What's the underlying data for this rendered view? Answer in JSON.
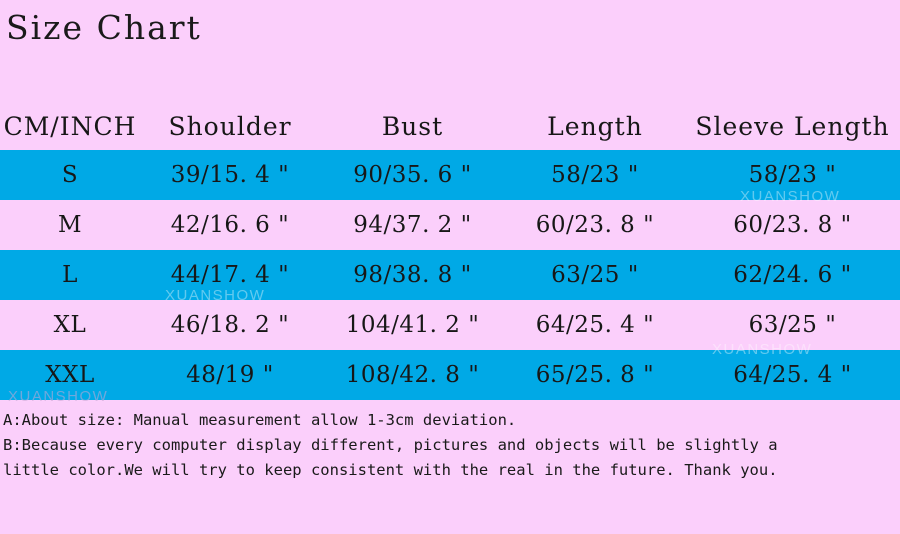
{
  "title": "Size Chart",
  "table": {
    "headers": [
      "CM/INCH",
      "Shoulder",
      "Bust",
      "Length",
      "Sleeve Length"
    ],
    "rows": [
      {
        "size": "S",
        "shoulder": "39/15. 4 \"",
        "bust": "90/35. 6 \"",
        "length": "58/23 \"",
        "sleeve": "58/23 \""
      },
      {
        "size": "M",
        "shoulder": "42/16. 6 \"",
        "bust": "94/37. 2 \"",
        "length": "60/23. 8 \"",
        "sleeve": "60/23. 8 \""
      },
      {
        "size": "L",
        "shoulder": "44/17. 4 \"",
        "bust": "98/38. 8 \"",
        "length": "63/25 \"",
        "sleeve": "62/24. 6 \""
      },
      {
        "size": "XL",
        "shoulder": "46/18. 2 \"",
        "bust": "104/41. 2 \"",
        "length": "64/25. 4 \"",
        "sleeve": "63/25 \""
      },
      {
        "size": "XXL",
        "shoulder": "48/19 \"",
        "bust": "108/42. 8 \"",
        "length": "65/25. 8 \"",
        "sleeve": "64/25. 4 \""
      }
    ]
  },
  "notes": [
    "A:About size: Manual measurement allow 1-3cm deviation.",
    "B:Because every computer display different, pictures and objects will be slightly a",
    "little color.We will try to keep consistent with the real in the future. Thank you."
  ],
  "watermark": {
    "text": "XUANSHOW"
  },
  "colors": {
    "background_pink": "#fbcffb",
    "row_blue": "#00a9e6",
    "text": "#171717"
  }
}
